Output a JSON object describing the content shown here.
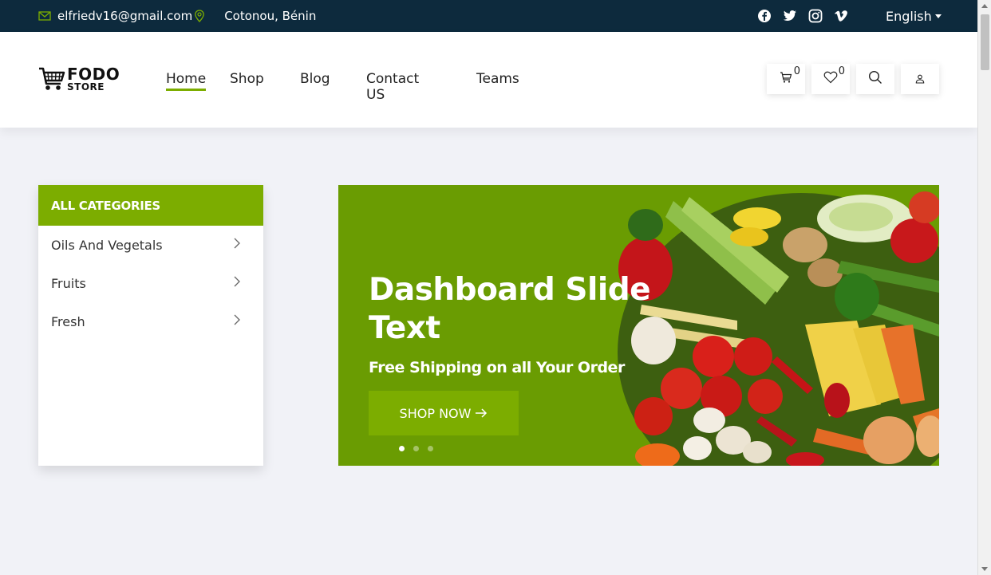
{
  "topbar": {
    "email": "elfriedv16@gmail.com",
    "location": "Cotonou, Bénin",
    "social": [
      "facebook-icon",
      "twitter-icon",
      "instagram-icon",
      "vimeo-icon"
    ],
    "language": "English"
  },
  "logo": {
    "line1": "FODO",
    "line2": "STORE"
  },
  "nav": {
    "items": [
      {
        "label": "Home",
        "active": true
      },
      {
        "label": "Shop"
      },
      {
        "label": "Blog"
      },
      {
        "label": "Contact US"
      },
      {
        "label": "Teams"
      }
    ]
  },
  "header_actions": {
    "cart_count": "0",
    "wishlist_count": "0"
  },
  "categories": {
    "title": "ALL CATEGORIES",
    "items": [
      {
        "label": "Oils And Vegetals"
      },
      {
        "label": "Fruits"
      },
      {
        "label": "Fresh"
      }
    ]
  },
  "hero": {
    "title": "Dashboard Slide Text",
    "subtitle": "Free Shipping on all Your Order",
    "button_label": "SHOP NOW",
    "active_slide": 1,
    "slide_count": 3
  },
  "colors": {
    "topbar": "#0d2a3d",
    "accent": "#7cad00",
    "hero_bg": "#6a9c02",
    "page_bg": "#f1f2f7"
  }
}
